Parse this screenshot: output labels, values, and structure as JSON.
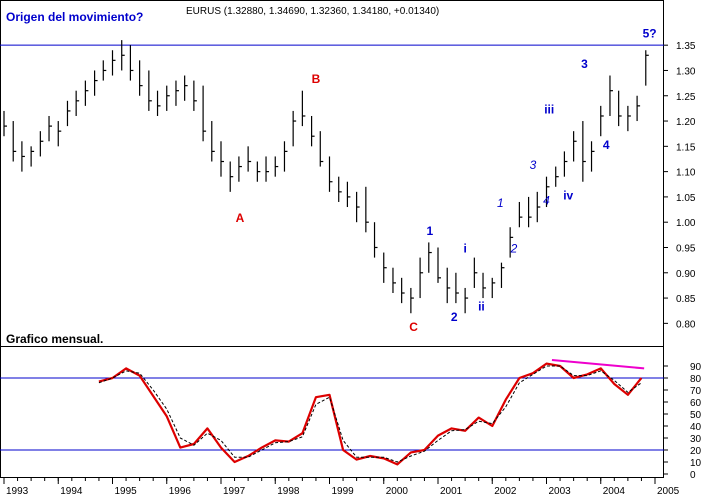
{
  "chart_data": [
    {
      "type": "bar",
      "subtype": "ohlc",
      "title": "Origen del movimiento?",
      "subtitle": "EURUS (1.32880, 1.34690, 1.32360, 1.34180, +0.01340)",
      "ylim": [
        0.775,
        1.38
      ],
      "y_ticks": [
        "0.80",
        "0.85",
        "0.90",
        "0.95",
        "1.00",
        "1.05",
        "1.10",
        "1.15",
        "1.20",
        "1.25",
        "1.30",
        "1.35"
      ],
      "grid": false,
      "resistance_line": {
        "y": 1.35,
        "color": "#0000cc"
      },
      "series": [
        {
          "x": [
            1993.0,
            1993.17,
            1993.33,
            1993.5,
            1993.67,
            1993.83,
            1994.0,
            1994.17,
            1994.33,
            1994.5,
            1994.67,
            1994.83,
            1995.0,
            1995.17,
            1995.33,
            1995.5,
            1995.67,
            1995.83,
            1996.0,
            1996.17,
            1996.33,
            1996.5,
            1996.67,
            1996.83,
            1997.0,
            1997.17,
            1997.33,
            1997.5,
            1997.67,
            1997.83,
            1998.0,
            1998.17,
            1998.33,
            1998.5,
            1998.67,
            1998.83,
            1999.0,
            1999.17,
            1999.33,
            1999.5,
            1999.67,
            1999.83,
            2000.0,
            2000.17,
            2000.33,
            2000.5,
            2000.67,
            2000.83,
            2001.0,
            2001.17,
            2001.33,
            2001.5,
            2001.67,
            2001.83,
            2002.0,
            2002.17,
            2002.33,
            2002.5,
            2002.67,
            2002.83,
            2003.0,
            2003.17,
            2003.33,
            2003.5,
            2003.67,
            2003.83,
            2004.0,
            2004.17,
            2004.33,
            2004.5,
            2004.67,
            2004.83
          ],
          "high": [
            1.22,
            1.2,
            1.16,
            1.15,
            1.18,
            1.21,
            1.2,
            1.24,
            1.26,
            1.28,
            1.3,
            1.32,
            1.34,
            1.36,
            1.35,
            1.32,
            1.3,
            1.26,
            1.27,
            1.28,
            1.29,
            1.28,
            1.27,
            1.2,
            1.16,
            1.12,
            1.13,
            1.15,
            1.12,
            1.13,
            1.13,
            1.16,
            1.22,
            1.26,
            1.21,
            1.18,
            1.13,
            1.09,
            1.08,
            1.06,
            1.07,
            1.0,
            0.94,
            0.91,
            0.89,
            0.87,
            0.93,
            0.96,
            0.95,
            0.91,
            0.9,
            0.87,
            0.93,
            0.9,
            0.89,
            0.92,
            0.99,
            1.04,
            1.05,
            1.06,
            1.09,
            1.11,
            1.14,
            1.18,
            1.2,
            1.16,
            1.23,
            1.29,
            1.26,
            1.23,
            1.25,
            1.34
          ],
          "low": [
            1.17,
            1.12,
            1.1,
            1.11,
            1.13,
            1.16,
            1.15,
            1.19,
            1.21,
            1.23,
            1.25,
            1.28,
            1.29,
            1.3,
            1.28,
            1.25,
            1.22,
            1.21,
            1.22,
            1.23,
            1.24,
            1.22,
            1.16,
            1.12,
            1.09,
            1.06,
            1.08,
            1.1,
            1.08,
            1.08,
            1.09,
            1.1,
            1.15,
            1.19,
            1.15,
            1.11,
            1.06,
            1.04,
            1.03,
            1.0,
            0.98,
            0.93,
            0.88,
            0.86,
            0.84,
            0.82,
            0.85,
            0.9,
            0.88,
            0.84,
            0.84,
            0.82,
            0.87,
            0.85,
            0.85,
            0.87,
            0.93,
            0.99,
            0.99,
            1.0,
            1.03,
            1.07,
            1.09,
            1.12,
            1.08,
            1.1,
            1.17,
            1.21,
            1.19,
            1.18,
            1.2,
            1.27
          ],
          "close": [
            1.19,
            1.14,
            1.13,
            1.14,
            1.16,
            1.19,
            1.18,
            1.22,
            1.24,
            1.26,
            1.28,
            1.3,
            1.32,
            1.33,
            1.3,
            1.27,
            1.24,
            1.23,
            1.25,
            1.26,
            1.27,
            1.24,
            1.18,
            1.14,
            1.12,
            1.09,
            1.11,
            1.12,
            1.1,
            1.1,
            1.11,
            1.14,
            1.2,
            1.21,
            1.17,
            1.12,
            1.08,
            1.06,
            1.05,
            1.03,
            1.0,
            0.95,
            0.91,
            0.88,
            0.86,
            0.85,
            0.9,
            0.94,
            0.89,
            0.87,
            0.86,
            0.85,
            0.9,
            0.87,
            0.88,
            0.91,
            0.97,
            1.01,
            1.01,
            1.03,
            1.07,
            1.09,
            1.12,
            1.16,
            1.12,
            1.14,
            1.21,
            1.26,
            1.21,
            1.21,
            1.23,
            1.33
          ]
        }
      ],
      "annotations": [
        {
          "text": "A",
          "x": 1997.35,
          "y": 1.0,
          "color": "#dd0000",
          "style": "bold"
        },
        {
          "text": "B",
          "x": 1998.75,
          "y": 1.275,
          "color": "#dd0000",
          "style": "bold"
        },
        {
          "text": "C",
          "x": 2000.55,
          "y": 0.785,
          "color": "#dd0000",
          "style": "bold"
        },
        {
          "text": "1",
          "x": 2000.85,
          "y": 0.975,
          "color": "#0000cc",
          "style": "bold"
        },
        {
          "text": "2",
          "x": 2001.3,
          "y": 0.805,
          "color": "#0000cc",
          "style": "bold"
        },
        {
          "text": "i",
          "x": 2001.5,
          "y": 0.94,
          "color": "#0000cc",
          "style": "bold"
        },
        {
          "text": "ii",
          "x": 2001.8,
          "y": 0.825,
          "color": "#0000cc",
          "style": "bold"
        },
        {
          "text": "1",
          "x": 2002.15,
          "y": 1.03,
          "color": "#0000cc",
          "style": "italic"
        },
        {
          "text": "2",
          "x": 2002.4,
          "y": 0.94,
          "color": "#0000cc",
          "style": "italic"
        },
        {
          "text": "3",
          "x": 2002.75,
          "y": 1.105,
          "color": "#0000cc",
          "style": "italic"
        },
        {
          "text": "4",
          "x": 2003.0,
          "y": 1.035,
          "color": "#0000cc",
          "style": "italic"
        },
        {
          "text": "iii",
          "x": 2003.05,
          "y": 1.215,
          "color": "#0000cc",
          "style": "bold"
        },
        {
          "text": "iv",
          "x": 2003.4,
          "y": 1.045,
          "color": "#0000cc",
          "style": "bold"
        },
        {
          "text": "3",
          "x": 2003.7,
          "y": 1.305,
          "color": "#0000cc",
          "style": "bold"
        },
        {
          "text": "4",
          "x": 2004.1,
          "y": 1.145,
          "color": "#0000cc",
          "style": "bold"
        },
        {
          "text": "5?",
          "x": 2004.9,
          "y": 1.365,
          "color": "#0000cc",
          "style": "bold"
        }
      ]
    },
    {
      "type": "line",
      "title": "Grafico mensual.",
      "ylim": [
        0,
        100
      ],
      "y_ticks": [
        "0",
        "10",
        "20",
        "30",
        "40",
        "50",
        "60",
        "70",
        "80",
        "90"
      ],
      "reference_lines": [
        {
          "y": 20,
          "color": "#0000cc"
        },
        {
          "y": 80,
          "color": "#0000cc"
        }
      ],
      "x_ticks": [
        "1993",
        "1994",
        "1995",
        "1996",
        "1997",
        "1998",
        "1999",
        "2000",
        "2001",
        "2002",
        "2003",
        "2004",
        "2005"
      ],
      "series": [
        {
          "color": "#dd0000",
          "style": "solid",
          "x": [
            1994.75,
            1995.0,
            1995.25,
            1995.5,
            1995.75,
            1996.0,
            1996.25,
            1996.5,
            1996.75,
            1997.0,
            1997.25,
            1997.5,
            1997.75,
            1998.0,
            1998.25,
            1998.5,
            1998.75,
            1999.0,
            1999.25,
            1999.5,
            1999.75,
            2000.0,
            2000.25,
            2000.5,
            2000.75,
            2001.0,
            2001.25,
            2001.5,
            2001.75,
            2002.0,
            2002.25,
            2002.5,
            2002.75,
            2003.0,
            2003.25,
            2003.5,
            2003.75,
            2004.0,
            2004.25,
            2004.5,
            2004.75
          ],
          "values": [
            77,
            80,
            88,
            82,
            65,
            48,
            22,
            25,
            38,
            22,
            10,
            15,
            22,
            28,
            27,
            34,
            64,
            66,
            20,
            12,
            15,
            13,
            8,
            18,
            20,
            32,
            38,
            36,
            47,
            40,
            62,
            80,
            84,
            92,
            90,
            80,
            83,
            88,
            75,
            66,
            80
          ]
        },
        {
          "color": "#000000",
          "style": "dashed",
          "x": [
            1994.75,
            1995.0,
            1995.25,
            1995.5,
            1995.75,
            1996.0,
            1996.25,
            1996.5,
            1996.75,
            1997.0,
            1997.25,
            1997.5,
            1997.75,
            1998.0,
            1998.25,
            1998.5,
            1998.75,
            1999.0,
            1999.25,
            1999.5,
            1999.75,
            2000.0,
            2000.25,
            2000.5,
            2000.75,
            2001.0,
            2001.25,
            2001.5,
            2001.75,
            2002.0,
            2002.25,
            2002.5,
            2002.75,
            2003.0,
            2003.25,
            2003.5,
            2003.75,
            2004.0,
            2004.25,
            2004.5,
            2004.75
          ],
          "values": [
            76,
            80,
            86,
            84,
            70,
            54,
            30,
            24,
            34,
            28,
            14,
            14,
            20,
            26,
            27,
            31,
            58,
            64,
            28,
            14,
            14,
            14,
            10,
            15,
            19,
            28,
            36,
            37,
            44,
            42,
            56,
            76,
            83,
            90,
            90,
            82,
            82,
            86,
            78,
            68,
            76
          ]
        }
      ],
      "divergence_line": {
        "x": [
          2003.1,
          2004.8
        ],
        "y": [
          95,
          88
        ],
        "color": "#ee00cc"
      }
    }
  ]
}
